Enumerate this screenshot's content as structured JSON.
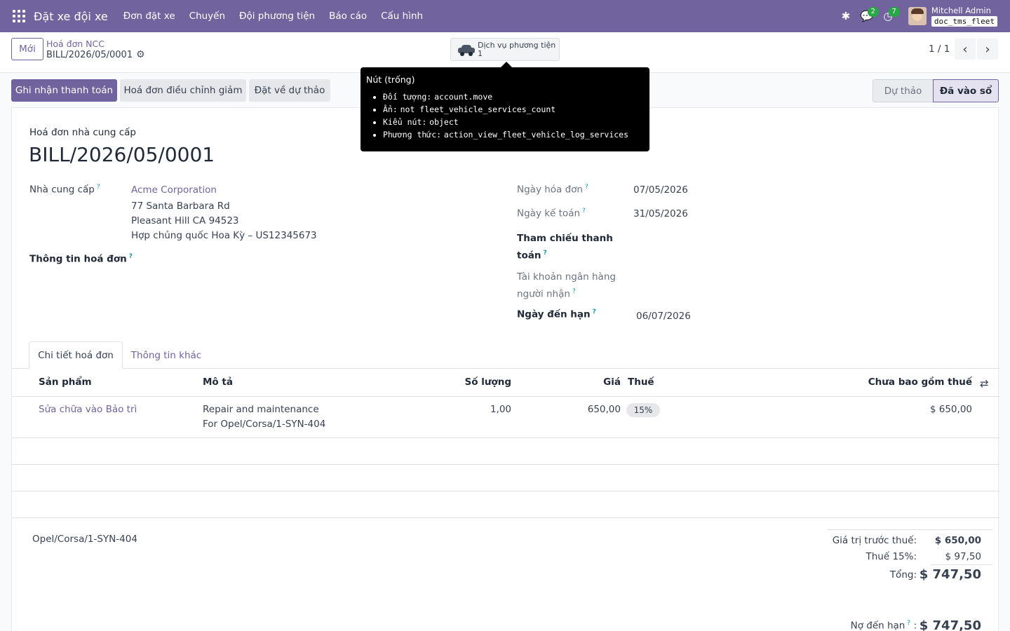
{
  "navbar": {
    "app_name": "Đặt xe đội xe",
    "menu": [
      "Đơn đặt xe",
      "Chuyến",
      "Đội phương tiện",
      "Báo cáo",
      "Cấu hình"
    ],
    "messages_count": "2",
    "activities_count": "7",
    "user_name": "Mitchell Admin",
    "db_name": "doc_tms_fleet"
  },
  "control_panel": {
    "new_button": "Mới",
    "breadcrumb_parent": "Hoá đơn NCC",
    "breadcrumb_current": "BILL/2026/05/0001",
    "smart_button_label": "Dịch vụ phương tiện",
    "smart_button_count": "1",
    "pager": "1 / 1"
  },
  "tooltip": {
    "title": "Nút (trống)",
    "items": [
      {
        "key": "Đối tượng:",
        "value": "account.move"
      },
      {
        "key": "Ẩn:",
        "value": "not fleet_vehicle_services_count"
      },
      {
        "key": "Kiểu nút:",
        "value": "object"
      },
      {
        "key": "Phương thức:",
        "value": "action_view_fleet_vehicle_log_services"
      }
    ]
  },
  "actions": {
    "register_payment": "Ghi nhận thanh toán",
    "credit_note": "Hoá đơn điều chỉnh giảm",
    "reset_draft": "Đặt về dự thảo"
  },
  "statusbar": {
    "draft": "Dự thảo",
    "posted": "Đã vào sổ"
  },
  "form": {
    "move_type": "Hoá đơn nhà cung cấp",
    "name": "BILL/2026/05/0001",
    "vendor_label": "Nhà cung cấp",
    "vendor_name": "Acme Corporation",
    "vendor_address": [
      "77 Santa Barbara Rd",
      "Pleasant Hill CA 94523",
      "Hợp chủng quốc Hoa Kỳ – US12345673"
    ],
    "bill_info_label": "Thông tin hoá đơn",
    "invoice_date_label": "Ngày hóa đơn",
    "invoice_date": "07/05/2026",
    "accounting_date_label": "Ngày kế toán",
    "accounting_date": "31/05/2026",
    "payment_ref_label_1": "Tham chiếu thanh",
    "payment_ref_label_2": "toán",
    "bank_label_1": "Tài khoản ngân hàng",
    "bank_label_2": "người nhận",
    "due_date_label": "Ngày đến hạn",
    "due_date": "06/07/2026"
  },
  "tabs": [
    "Chi tiết hoá đơn",
    "Thông tin khác"
  ],
  "lines": {
    "headers": {
      "product": "Sản phẩm",
      "description": "Mô tả",
      "quantity": "Số lượng",
      "price": "Giá",
      "taxes": "Thuế",
      "subtotal": "Chưa bao gồm thuế"
    },
    "rows": [
      {
        "product": "Sửa chữa vào Bảo trì",
        "description_1": "Repair and maintenance",
        "description_2": "For Opel/Corsa/1-SYN-404",
        "quantity": "1,00",
        "price": "650,00",
        "tax": "15%",
        "subtotal": "$ 650,00"
      }
    ]
  },
  "footer": {
    "narration": "Opel/Corsa/1-SYN-404",
    "untaxed_label": "Giá trị trước thuế:",
    "untaxed_value": "$ 650,00",
    "tax_label": "Thuế 15%:",
    "tax_value": "$ 97,50",
    "total_label": "Tổng:",
    "total_value": "$ 747,50",
    "amount_due_label": "Nợ đến hạn",
    "amount_due_value": "$ 747,50"
  }
}
